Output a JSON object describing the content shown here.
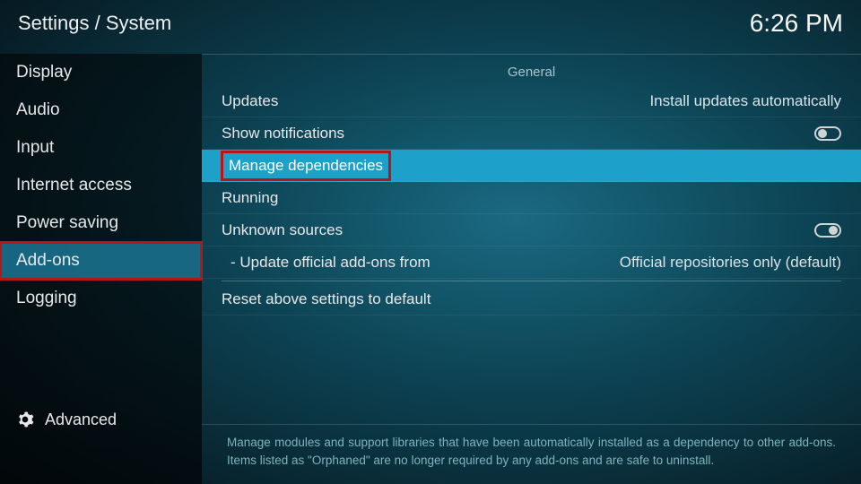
{
  "header": {
    "breadcrumb": "Settings / System",
    "time": "6:26 PM"
  },
  "sidebar": {
    "items": [
      {
        "label": "Display",
        "selected": false,
        "highlight": false
      },
      {
        "label": "Audio",
        "selected": false,
        "highlight": false
      },
      {
        "label": "Input",
        "selected": false,
        "highlight": false
      },
      {
        "label": "Internet access",
        "selected": false,
        "highlight": false
      },
      {
        "label": "Power saving",
        "selected": false,
        "highlight": false
      },
      {
        "label": "Add-ons",
        "selected": true,
        "highlight": true
      },
      {
        "label": "Logging",
        "selected": false,
        "highlight": false
      }
    ],
    "footer": "Advanced"
  },
  "main": {
    "section": "General",
    "rows": [
      {
        "label": "Updates",
        "value": "Install updates automatically",
        "type": "value",
        "selected": false,
        "highlight": false,
        "sub": false
      },
      {
        "label": "Show notifications",
        "value": null,
        "type": "toggle",
        "toggle_on": false,
        "selected": false,
        "highlight": false,
        "sub": false
      },
      {
        "label": "Manage dependencies",
        "value": null,
        "type": "action",
        "selected": true,
        "highlight": true,
        "sub": false
      },
      {
        "label": "Running",
        "value": null,
        "type": "action",
        "selected": false,
        "highlight": false,
        "sub": false
      },
      {
        "label": "Unknown sources",
        "value": null,
        "type": "toggle",
        "toggle_on": true,
        "selected": false,
        "highlight": false,
        "sub": false
      },
      {
        "label": "- Update official add-ons from",
        "value": "Official repositories only (default)",
        "type": "value",
        "selected": false,
        "highlight": false,
        "sub": true
      },
      {
        "divider": true
      },
      {
        "label": "Reset above settings to default",
        "value": null,
        "type": "action",
        "selected": false,
        "highlight": false,
        "sub": false
      }
    ],
    "description": "Manage modules and support libraries that have been automatically installed as a dependency to other add-ons. Items listed as \"Orphaned\" are no longer required by any add-ons and are safe to uninstall."
  }
}
